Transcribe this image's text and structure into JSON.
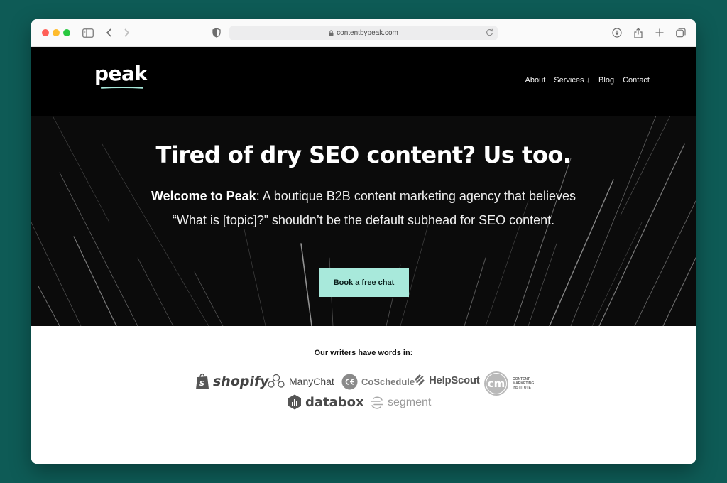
{
  "browser": {
    "url": "contentbypeak.com"
  },
  "site": {
    "logo_text": "peak",
    "nav": [
      {
        "label": "About"
      },
      {
        "label": "Services ↓"
      },
      {
        "label": "Blog"
      },
      {
        "label": "Contact"
      }
    ]
  },
  "hero": {
    "headline": "Tired of dry SEO content? Us too.",
    "intro_bold": "Welcome to Peak",
    "intro_rest": ": A boutique B2B content marketing agency that believes “What is [topic]?” shouldn’t be the default subhead for SEO content.",
    "cta_label": "Book a free chat"
  },
  "logos": {
    "heading": "Our writers have words in:",
    "brands": [
      {
        "name": "shopify"
      },
      {
        "name": "ManyChat"
      },
      {
        "name": "CoSchedule"
      },
      {
        "name": "HelpScout"
      },
      {
        "name": "CONTENT MARKETING INSTITUTE",
        "line1": "CONTENT",
        "line2": "MARKETING",
        "line3": "INSTITUTE",
        "badge": "cm"
      },
      {
        "name": "databox"
      },
      {
        "name": "segment"
      }
    ]
  },
  "colors": {
    "page_bg": "#0e5b56",
    "accent": "#a8e9db",
    "header_bg": "#000000"
  }
}
